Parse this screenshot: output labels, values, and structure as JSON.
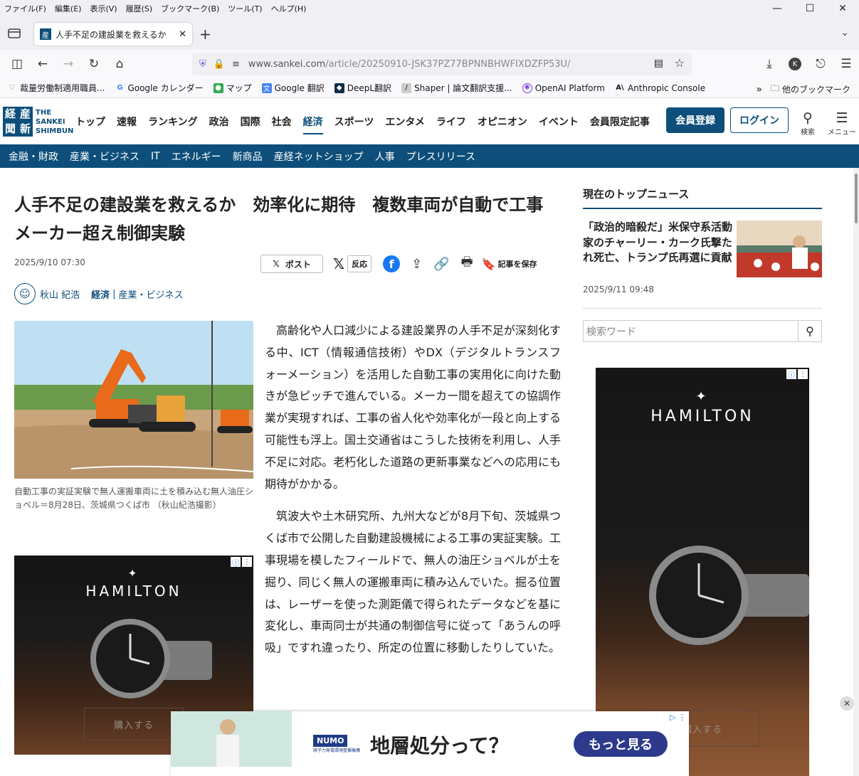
{
  "menu": [
    "ファイル(F)",
    "編集(E)",
    "表示(V)",
    "履歴(S)",
    "ブックマーク(B)",
    "ツール(T)",
    "ヘルプ(H)"
  ],
  "tab": {
    "title": "人手不足の建設業を救えるか　効",
    "favicon": "産"
  },
  "url": {
    "host": "www.sankei.com",
    "path": "/article/20250910-JSK37PZ77BPNNBHWFIXDZFP53U/"
  },
  "bookmarks": [
    {
      "label": "裁量労働制適用職員...",
      "icon": "heart-outline-icon"
    },
    {
      "label": "Google カレンダー",
      "icon": "google-icon"
    },
    {
      "label": "マップ",
      "icon": "maps-icon"
    },
    {
      "label": "Google 翻訳",
      "icon": "translate-icon"
    },
    {
      "label": "DeepL翻訳",
      "icon": "deepl-icon"
    },
    {
      "label": "Shaper | 論文翻訳支援...",
      "icon": "shaper-icon"
    },
    {
      "label": "OpenAI Platform",
      "icon": "openai-icon"
    },
    {
      "label": "Anthropic Console",
      "icon": "anthropic-icon"
    }
  ],
  "other_bookmarks": "他のブックマーク",
  "site": {
    "logo_en": [
      "THE",
      "SANKEI",
      "SHIMBUN"
    ],
    "logo_jp": [
      "産",
      "経",
      "新",
      "聞"
    ],
    "nav": [
      "トップ",
      "速報",
      "ランキング",
      "政治",
      "国際",
      "社会",
      "経済",
      "スポーツ",
      "エンタメ",
      "ライフ",
      "オピニオン",
      "イベント",
      "会員限定記事"
    ],
    "register": "会員登録",
    "login": "ログイン",
    "search_label": "検索",
    "menu_label": "メニュー",
    "subnav": [
      "金融・財政",
      "産業・ビジネス",
      "IT",
      "エネルギー",
      "新商品",
      "産経ネットショップ",
      "人事",
      "プレスリリース"
    ]
  },
  "article": {
    "title": "人手不足の建設業を救えるか　効率化に期待　複数車両が自動で工事　メーカー超え制御実験",
    "date": "2025/9/10 07:30",
    "share": {
      "post": "ポスト",
      "react": "反応",
      "save": "記事を保存"
    },
    "author": "秋山 紀浩",
    "category": "経済",
    "subcategory": "産業・ビジネス",
    "caption": "自動工事の実証実験で無人運搬車両に土を積み込む無人油圧ショベル＝8月28日、茨城県つくば市 （秋山紀浩撮影）",
    "paragraphs": [
      "高齢化や人口減少による建設業界の人手不足が深刻化する中、ICT（情報通信技術）やDX（デジタルトランスフォーメーション）を活用した自動工事の実用化に向けた動きが急ピッチで進んでいる。メーカー間を超えての協調作業が実現すれば、工事の省人化や効率化が一段と向上する可能性も浮上。国土交通省はこうした技術を利用し、人手不足に対応。老朽化した道路の更新事業などへの応用にも期待がかかる。",
      "筑波大や土木研究所、九州大などが8月下旬、茨城県つくば市で公開した自動建設機械による工事の実証実験。工事現場を模したフィールドで、無人の油圧ショベルが土を掘り、同じく無人の運搬車両に積み込んでいた。掘る位置は、レーザーを使った測距儀で得られたデータなどを基に変化し、車両同士が共通の制御信号に従って「あうんの呼吸」ですれ違ったり、所定の位置に移動したりしていた。"
    ]
  },
  "ad": {
    "brand": "HAMILTON",
    "buy": "購入する"
  },
  "sidebar": {
    "title": "現在のトップニュース",
    "news_title": "「政治的暗殺だ」米保守系活動家のチャーリー・カーク氏撃たれ死亡、トランプ氏再選に貢献",
    "news_date": "2025/9/11 09:48",
    "search_placeholder": "検索ワード"
  },
  "bottom_ad": {
    "brand": "NUMO",
    "brand_sub": "原子力発電環境整備機構",
    "headline": "地層処分って？",
    "cta": "もっと見る"
  },
  "colors": {
    "brand": "#0d4f7a",
    "cta": "#2d3a8c"
  }
}
